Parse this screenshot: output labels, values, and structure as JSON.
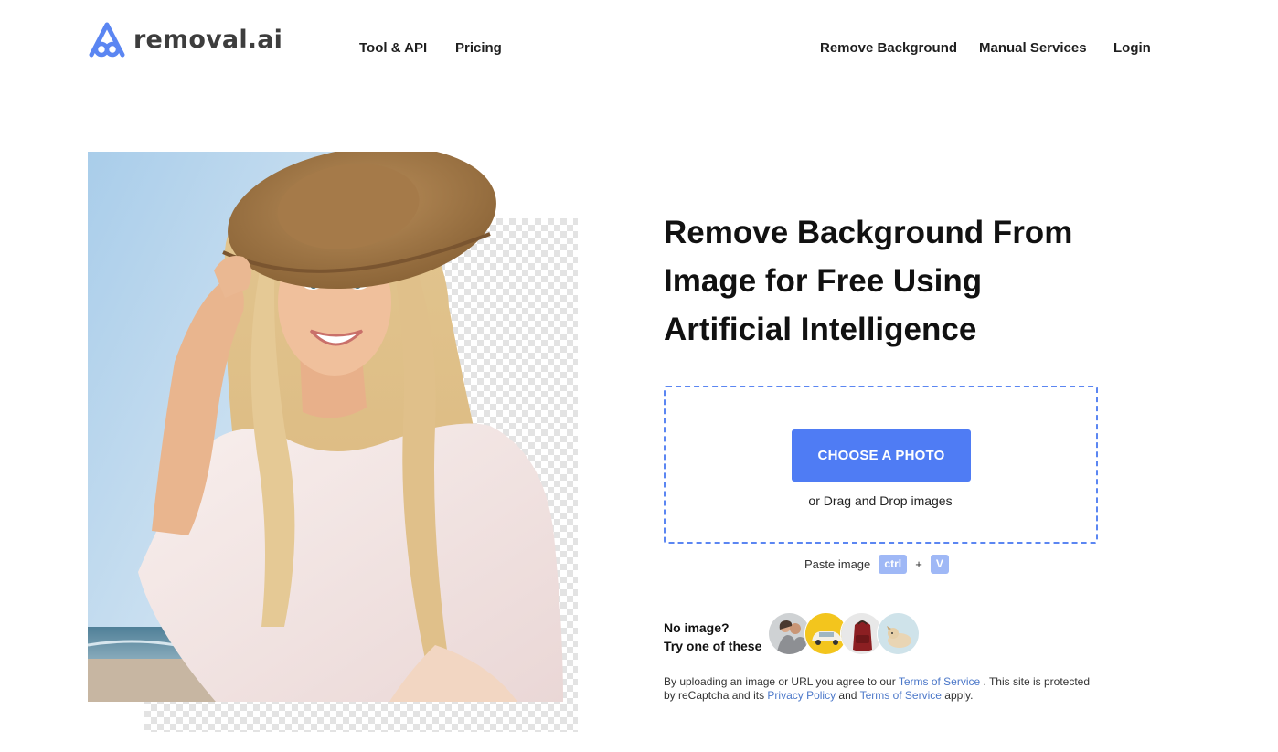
{
  "header": {
    "logo_text": "removal.ai",
    "nav_left": [
      "Tool & API",
      "Pricing"
    ],
    "nav_right": [
      "Remove Background",
      "Manual Services",
      "Login"
    ]
  },
  "hero": {
    "headline_lines": [
      "Remove Background From",
      "Image for Free Using",
      "Artificial Intelligence"
    ]
  },
  "upload": {
    "button_label": "CHOOSE A PHOTO",
    "drag_text": "or Drag and Drop images",
    "paste_label": "Paste image",
    "key_ctrl": "ctrl",
    "plus": "+",
    "key_v": "V"
  },
  "samples": {
    "label_line1": "No image?",
    "label_line2": "Try one of these",
    "items": [
      "couple-photo",
      "yellow-car-photo",
      "red-backpack-photo",
      "dog-photo"
    ]
  },
  "legal": {
    "part1": "By uploading an image or URL you agree to our ",
    "terms1": "Terms of Service",
    "part2": " . This site is protected by reCaptcha and its ",
    "privacy": "Privacy Policy",
    "part3": " and ",
    "terms2": "Terms of Service",
    "part4": " apply."
  },
  "colors": {
    "accent": "#4f7cf4",
    "dropzone_border": "#5b86f2",
    "key_bg": "#9fb8f6",
    "link": "#4c78c9"
  }
}
